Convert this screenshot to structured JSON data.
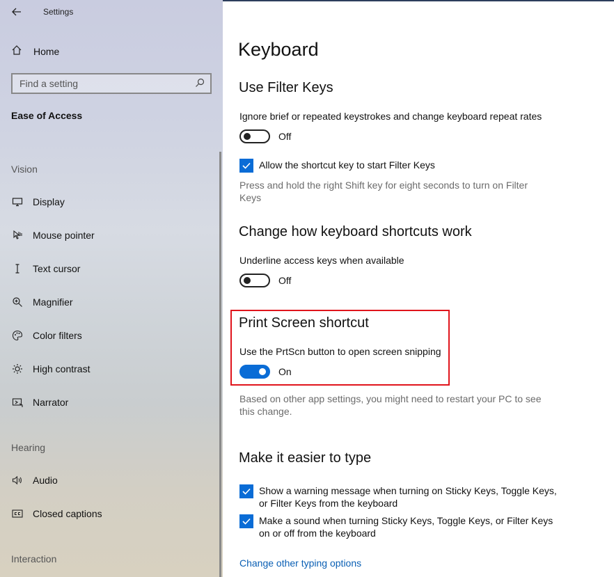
{
  "window": {
    "title": "Settings",
    "back_label": "←"
  },
  "sidebar": {
    "home_label": "Home",
    "search_placeholder": "Find a setting",
    "section_title": "Ease of Access",
    "groups": {
      "vision": "Vision",
      "hearing": "Hearing",
      "interaction": "Interaction"
    },
    "items": {
      "display": "Display",
      "mouse_pointer": "Mouse pointer",
      "text_cursor": "Text cursor",
      "magnifier": "Magnifier",
      "color_filters": "Color filters",
      "high_contrast": "High contrast",
      "narrator": "Narrator",
      "audio": "Audio",
      "closed_captions": "Closed captions"
    }
  },
  "main": {
    "title": "Keyboard",
    "filter_keys": {
      "heading": "Use Filter Keys",
      "desc": "Ignore brief or repeated keystrokes and change keyboard repeat rates",
      "toggle_state": "Off",
      "toggle_on": false,
      "checkbox_label": "Allow the shortcut key to start Filter Keys",
      "checkbox_checked": true,
      "hint": "Press and hold the right Shift key for eight seconds to turn on Filter Keys"
    },
    "shortcuts": {
      "heading": "Change how keyboard shortcuts work",
      "desc": "Underline access keys when available",
      "toggle_state": "Off",
      "toggle_on": false
    },
    "print_screen": {
      "heading": "Print Screen shortcut",
      "desc": "Use the PrtScn button to open screen snipping",
      "toggle_state": "On",
      "toggle_on": true,
      "note": "Based on other app settings, you might need to restart your PC to see this change."
    },
    "easier_type": {
      "heading": "Make it easier to type",
      "check1": "Show a warning message when turning on Sticky Keys, Toggle Keys, or Filter Keys from the keyboard",
      "check2": "Make a sound when turning Sticky Keys, Toggle Keys, or Filter Keys on or off from the keyboard",
      "link": "Change other typing options"
    }
  },
  "colors": {
    "accent": "#0a6cd6",
    "highlight_border": "#e0141c",
    "link": "#0a5fb4"
  }
}
